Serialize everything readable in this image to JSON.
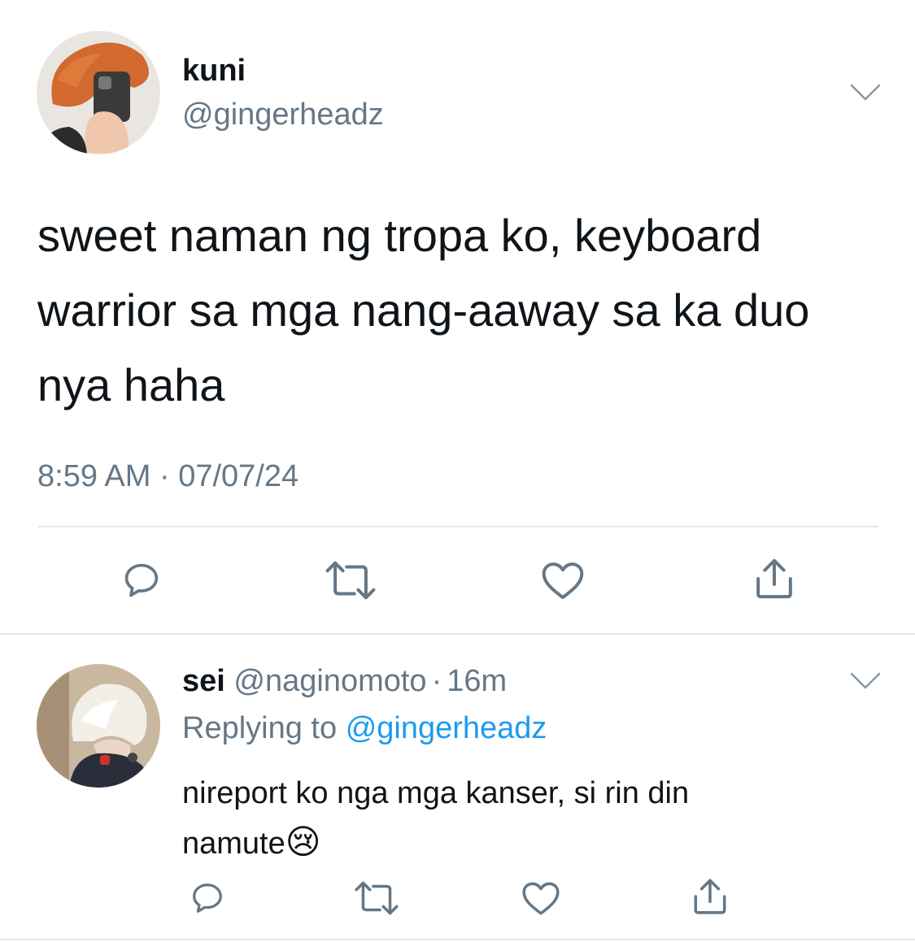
{
  "tweet": {
    "display_name": "kuni",
    "handle": "@gingerheadz",
    "text_lines": [
      "sweet naman ng tropa ko, keyboard",
      "warrior sa mga nang-aaway sa ka duo",
      "nya haha"
    ],
    "timestamp": "8:59 AM · 07/07/24"
  },
  "reply": {
    "display_name": "sei",
    "handle": "@naginomoto",
    "separator": "·",
    "age": "16m",
    "replying_prefix": "Replying to",
    "replying_handle": "@gingerheadz",
    "text_line1": "nireport ko nga mga kanser, si rin din",
    "text_line2": "namute",
    "emoji": "😢"
  },
  "icons": {
    "actions": [
      "reply-icon",
      "retweet-icon",
      "like-icon",
      "share-icon"
    ],
    "menu": "chevron-down-icon"
  },
  "colors": {
    "text": "#0f1419",
    "muted": "#657786",
    "link": "#1d9bf0",
    "divider": "#e6e9ec"
  }
}
